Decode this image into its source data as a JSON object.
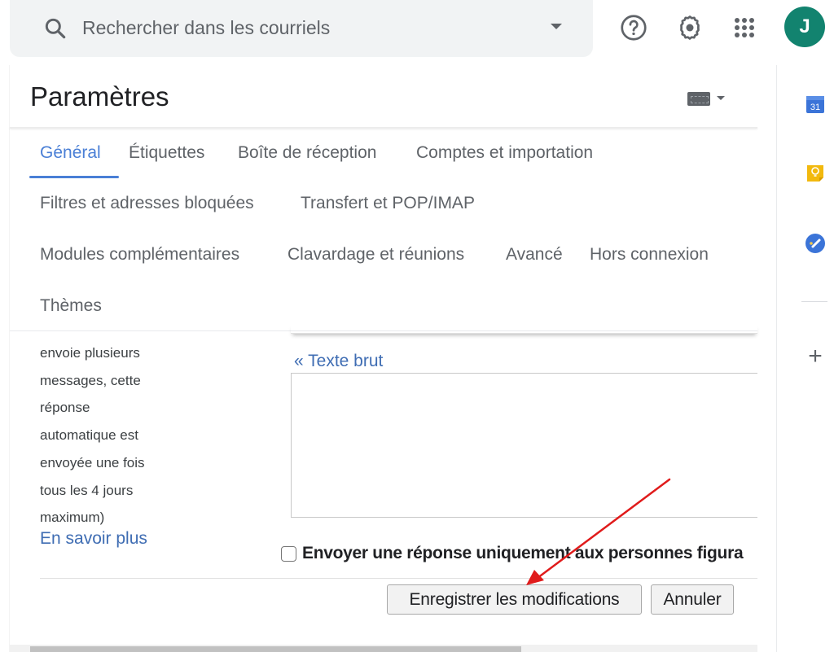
{
  "search": {
    "placeholder": "Rechercher dans les courriels",
    "icon": "search-icon",
    "options_icon": "caret-down-icon"
  },
  "header_icons": {
    "help": "help-icon",
    "settings": "gear-icon",
    "apps": "apps-grid-icon"
  },
  "account": {
    "initial": "J",
    "avatar_color": "#12836f"
  },
  "settings": {
    "title": "Paramètres",
    "input_tools_icon": "keyboard-icon",
    "tabs": [
      {
        "label": "Général",
        "active": true
      },
      {
        "label": "Étiquettes",
        "active": false
      },
      {
        "label": "Boîte de réception",
        "active": false
      },
      {
        "label": "Comptes et importation",
        "active": false
      },
      {
        "label": "Filtres et adresses bloquées",
        "active": false
      },
      {
        "label": "Transfert et POP/IMAP",
        "active": false
      },
      {
        "label": "Modules complémentaires",
        "active": false
      },
      {
        "label": "Clavardage et réunions",
        "active": false
      },
      {
        "label": "Avancé",
        "active": false
      },
      {
        "label": "Hors connexion",
        "active": false
      },
      {
        "label": "Thèmes",
        "active": false
      }
    ],
    "accent_color": "#4a7fd6"
  },
  "vacation": {
    "description_lines": [
      "envoie plusieurs",
      "messages, cette",
      "réponse",
      "automatique est",
      "envoyée une fois",
      "tous les 4 jours",
      "maximum)"
    ],
    "learn_more": "En savoir plus",
    "plain_text_link": "« Texte brut",
    "message_value": "",
    "contacts_only_label": "Envoyer une réponse uniquement aux personnes figura",
    "contacts_only_checked": false
  },
  "footer": {
    "save_label": "Enregistrer les modifications",
    "cancel_label": "Annuler"
  },
  "side_panel": {
    "calendar_day": "31",
    "calendar_icon": "calendar-icon",
    "keep_icon": "keep-icon",
    "tasks_icon": "tasks-icon",
    "add_icon": "plus-icon"
  },
  "annotation": {
    "arrow_color": "#e01b1b",
    "points_to": "Enregistrer les modifications"
  }
}
